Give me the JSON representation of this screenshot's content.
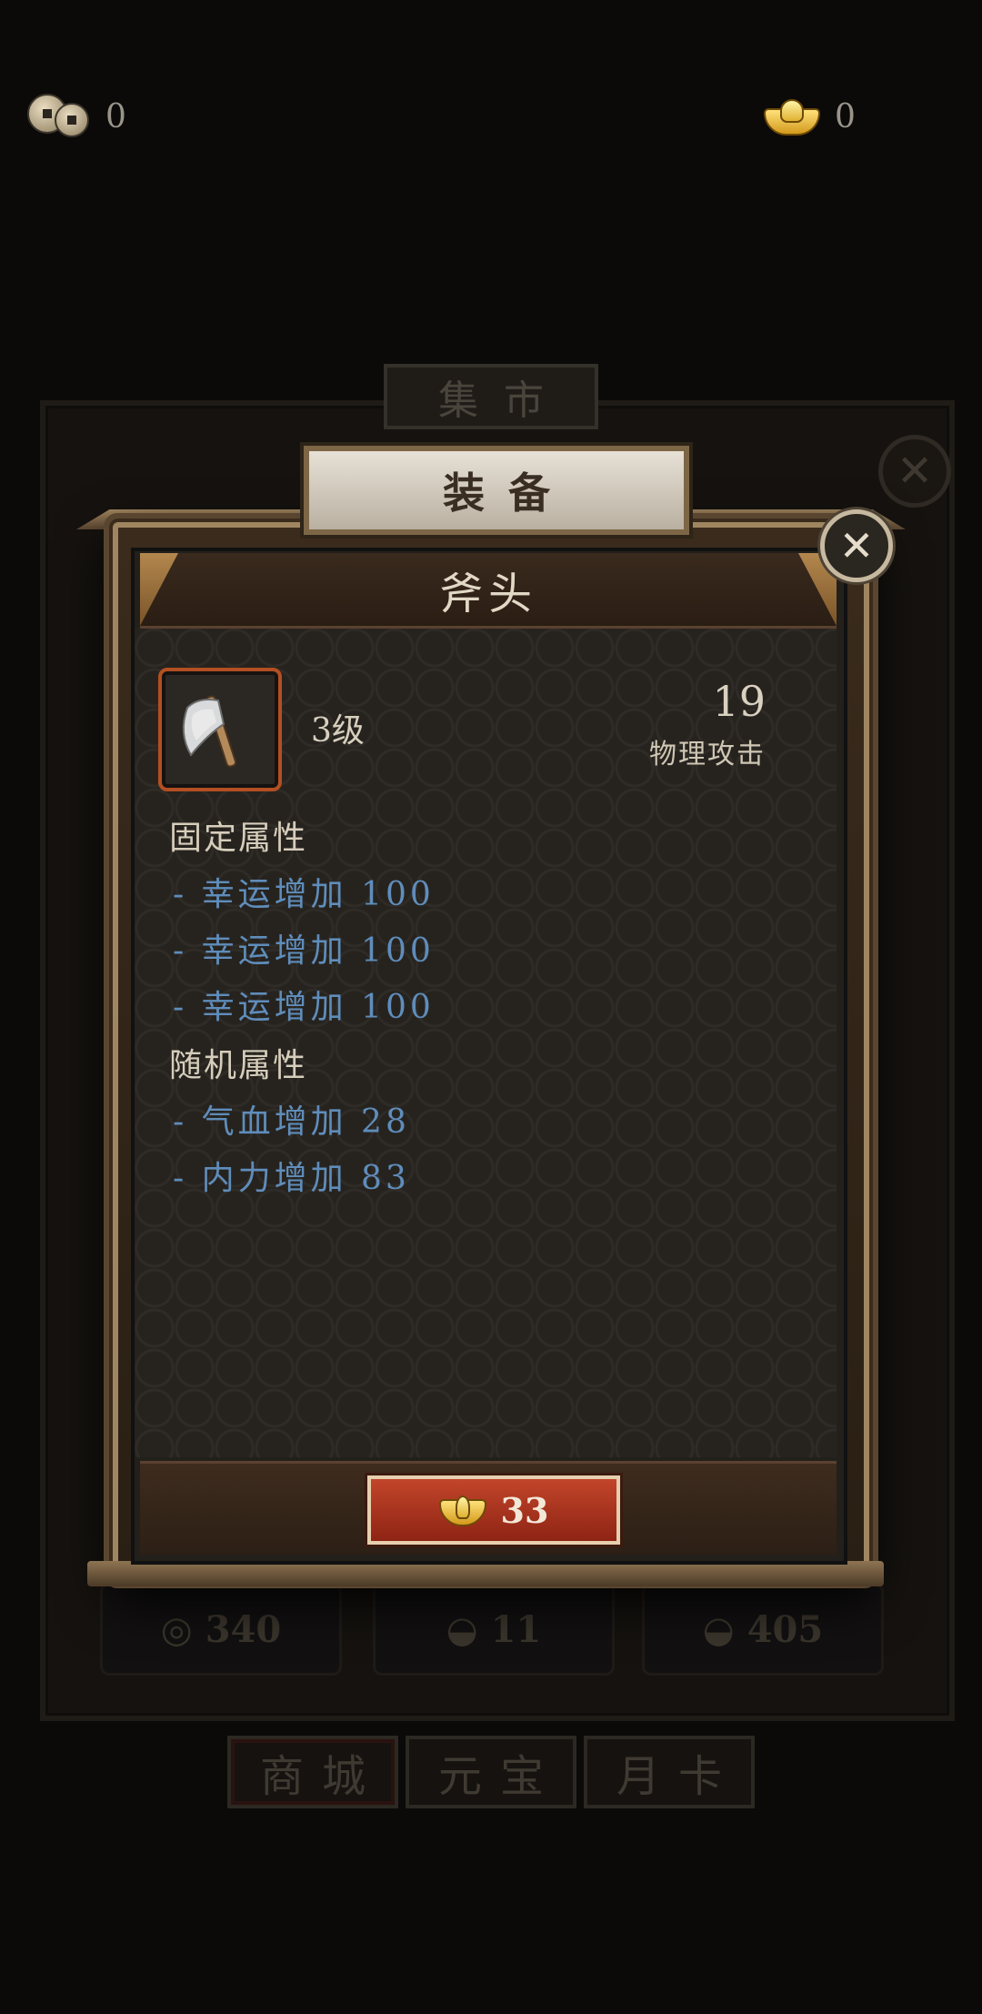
{
  "top_bar": {
    "coins": "0",
    "ingots": "0"
  },
  "background": {
    "market_tab": "集市",
    "prices": [
      "340",
      "11",
      "405"
    ],
    "tabs": [
      "商城",
      "元宝",
      "月卡"
    ]
  },
  "modal": {
    "title": "装备",
    "item_name": "斧头",
    "level": "3级",
    "stat_value": "19",
    "stat_label": "物理攻击",
    "fixed_header": "固定属性",
    "fixed_attrs": [
      "- 幸运增加 100",
      "- 幸运增加 100",
      "- 幸运增加 100"
    ],
    "random_header": "随机属性",
    "random_attrs": [
      "- 气血增加 28",
      "- 内力增加 83"
    ],
    "price": "33"
  },
  "colors": {
    "attribute_blue": "#5f8dbb",
    "buy_button_red": "#b23a22",
    "frame_bronze": "#a08660"
  },
  "icons": [
    "coin-icon",
    "ingot-icon",
    "close-icon",
    "axe-icon"
  ]
}
